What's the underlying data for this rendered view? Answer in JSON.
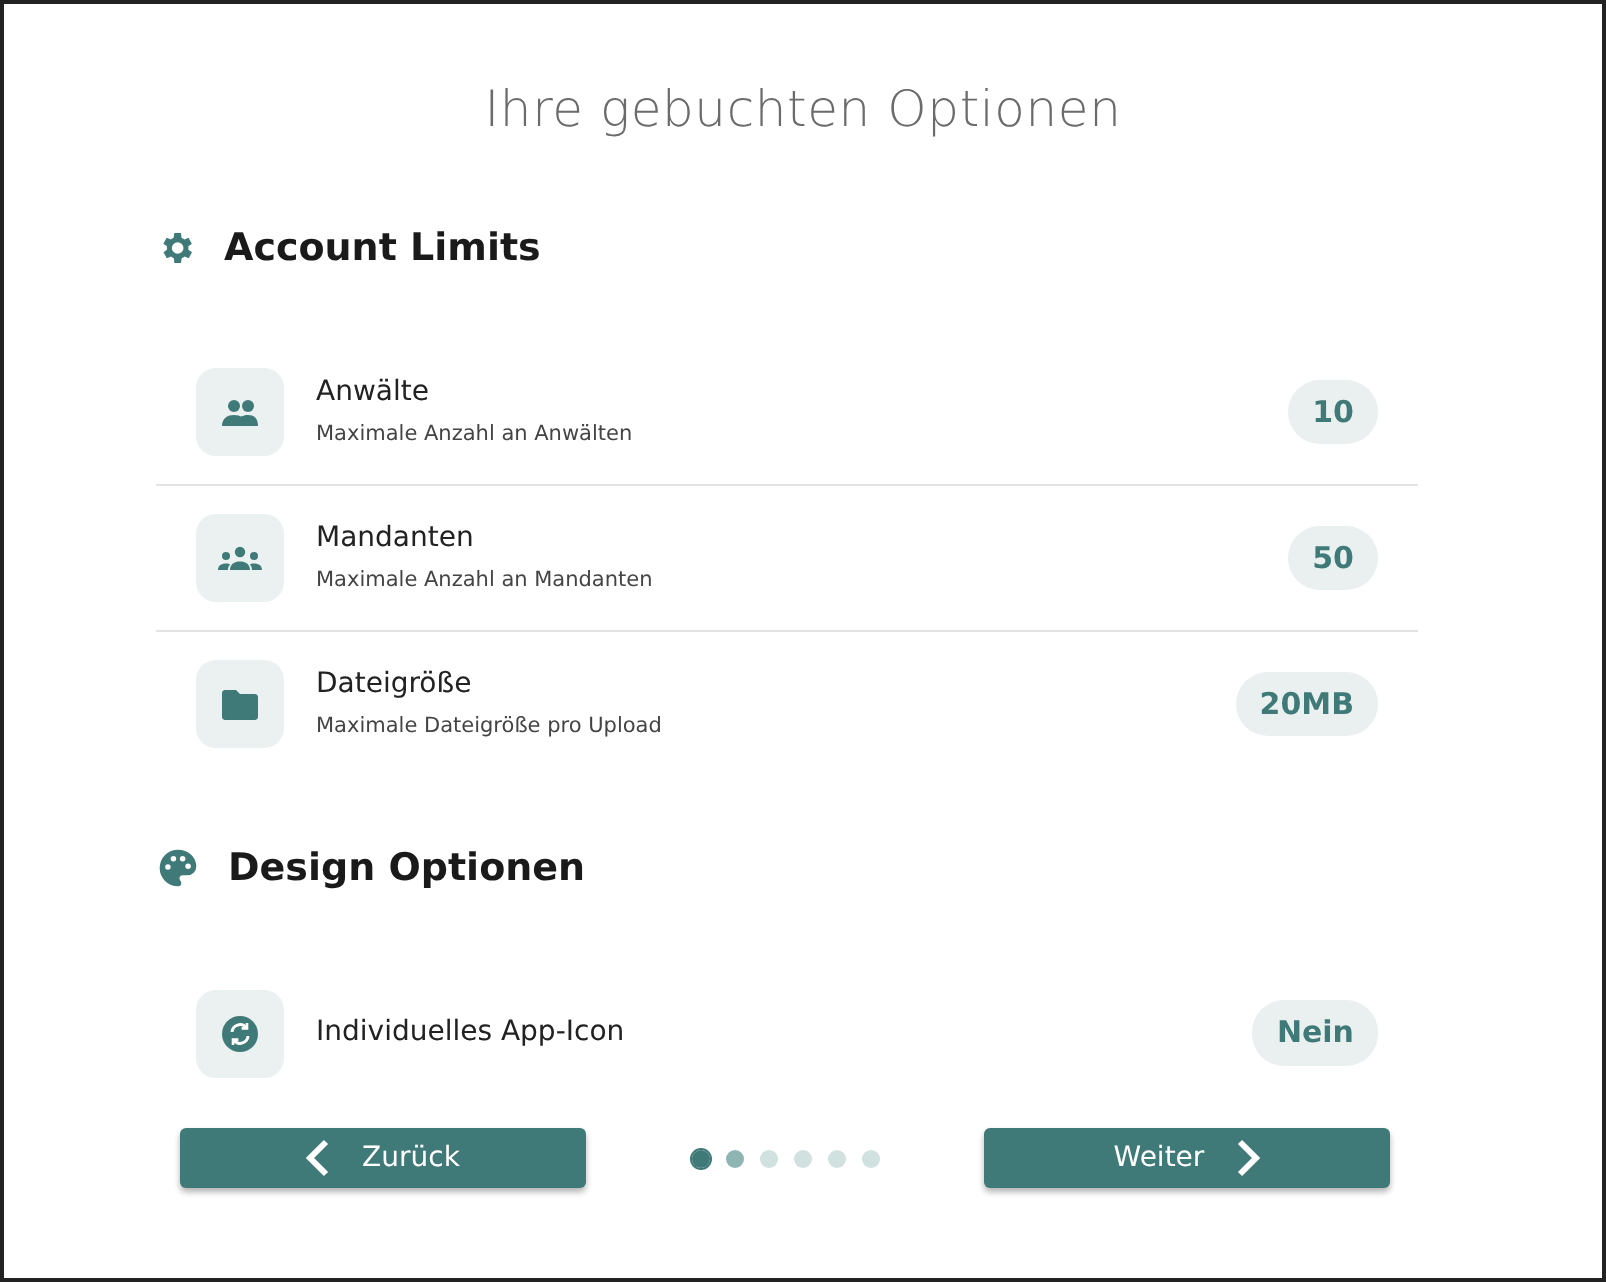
{
  "title": "Ihre gebuchten Optionen",
  "sections": [
    {
      "heading": "Account Limits",
      "items": [
        {
          "name": "Anwälte",
          "description": "Maximale Anzahl an Anwälten",
          "value": "10"
        },
        {
          "name": "Mandanten",
          "description": "Maximale Anzahl an Mandanten",
          "value": "50"
        },
        {
          "name": "Dateigröße",
          "description": "Maximale Dateigröße pro Upload",
          "value": "20MB"
        }
      ]
    },
    {
      "heading": "Design Optionen",
      "items": [
        {
          "name": "Individuelles App-Icon",
          "value": "Nein"
        }
      ]
    }
  ],
  "nav": {
    "back": "Zurück",
    "next": "Weiter",
    "dots": [
      {
        "selected": true,
        "color": "#3f7a78"
      },
      {
        "selected": false,
        "color": "#8fb5b3"
      },
      {
        "selected": false,
        "color": "#d0e1e0"
      },
      {
        "selected": false,
        "color": "#d0e1e0"
      },
      {
        "selected": false,
        "color": "#d0e1e0"
      },
      {
        "selected": false,
        "color": "#d0e1e0"
      }
    ]
  }
}
